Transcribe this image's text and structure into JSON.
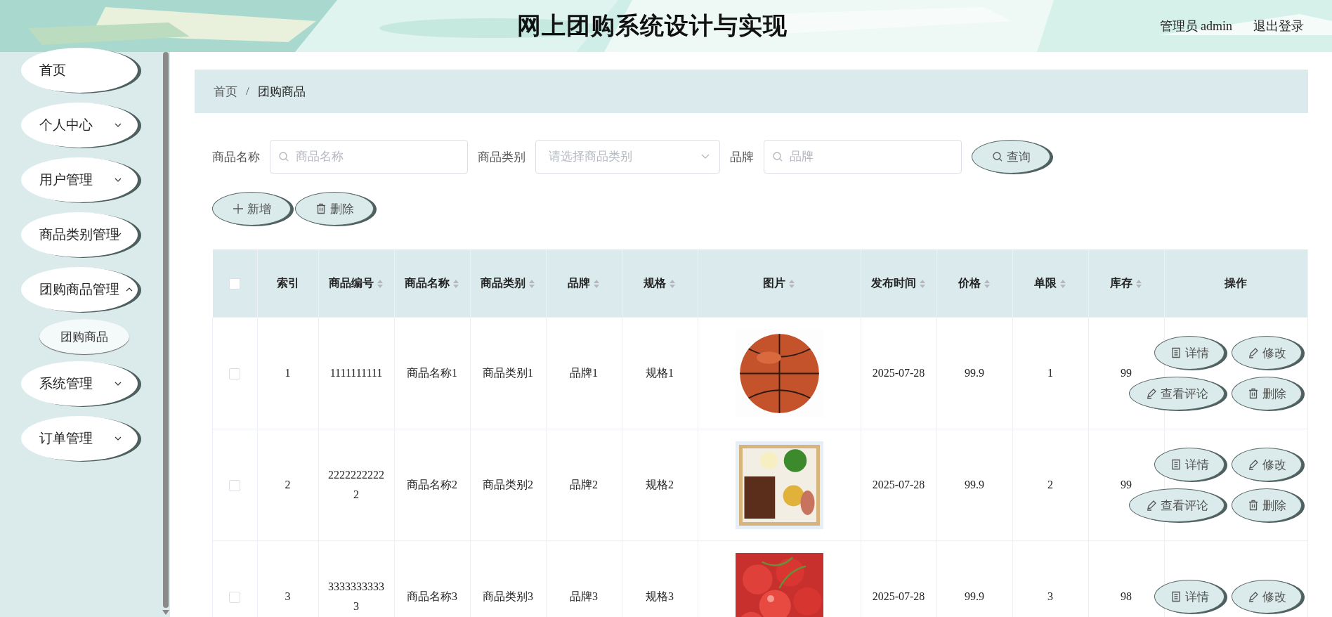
{
  "header": {
    "title": "网上团购系统设计与实现",
    "user": "管理员 admin",
    "logout": "退出登录",
    "background": {
      "kind": "picture"
    }
  },
  "sidebar": {
    "items": [
      {
        "label": "首页",
        "selected": false
      },
      {
        "label": "个人中心",
        "expanded": false,
        "selected": false
      },
      {
        "label": "用户管理",
        "expanded": false,
        "selected": false
      },
      {
        "label": "商品类别管理",
        "expanded": false,
        "selected": false
      },
      {
        "label": "团购商品管理",
        "expanded": true,
        "selected": false,
        "children": [
          {
            "label": "团购商品",
            "selected": true
          }
        ]
      },
      {
        "label": "系统管理",
        "expanded": false,
        "selected": false
      },
      {
        "label": "订单管理",
        "expanded": false,
        "selected": false
      }
    ]
  },
  "breadcrumb": [
    {
      "label": "首页"
    },
    {
      "label": "团购商品"
    }
  ],
  "breadcrumb_separator": "/",
  "filters": [
    {
      "kind": "text",
      "label": "商品名称",
      "placeholder": "商品名称"
    },
    {
      "kind": "select",
      "label": "商品类别",
      "placeholder": "请选择商品类别"
    },
    {
      "kind": "text",
      "label": "品牌",
      "placeholder": "品牌"
    }
  ],
  "search_button": "查询",
  "toolbar": [
    {
      "kind": "add",
      "label": "新增"
    },
    {
      "kind": "delete",
      "label": "删除"
    }
  ],
  "table": {
    "header_checked": false,
    "columns": [
      {
        "label": "索引",
        "sortable": false
      },
      {
        "label": "商品编号",
        "sortable": true
      },
      {
        "label": "商品名称",
        "sortable": true
      },
      {
        "label": "商品类别",
        "sortable": true
      },
      {
        "label": "品牌",
        "sortable": true
      },
      {
        "label": "规格",
        "sortable": true
      },
      {
        "label": "图片",
        "sortable": true
      },
      {
        "label": "发布时间",
        "sortable": true
      },
      {
        "label": "价格",
        "sortable": true
      },
      {
        "label": "单限",
        "sortable": true
      },
      {
        "label": "库存",
        "sortable": true
      },
      {
        "label": "操作",
        "sortable": false
      }
    ],
    "rows": [
      {
        "checked": false,
        "cells": [
          "1",
          "1111111111",
          "商品名称1",
          "商品类别1",
          "品牌1",
          "规格1",
          null,
          "2025-07-28",
          "99.9",
          "1",
          "99"
        ],
        "image": {
          "kind": "picture"
        },
        "actions": [
          {
            "kind": "detail",
            "label": "详情"
          },
          {
            "kind": "edit",
            "label": "修改"
          },
          {
            "kind": "comments",
            "label": "查看评论"
          },
          {
            "kind": "delete",
            "label": "删除"
          }
        ]
      },
      {
        "checked": false,
        "cells": [
          "2",
          "22222222222",
          "商品名称2",
          "商品类别2",
          "品牌2",
          "规格2",
          null,
          "2025-07-28",
          "99.9",
          "2",
          "99"
        ],
        "image": {
          "kind": "picture"
        },
        "actions": [
          {
            "kind": "detail",
            "label": "详情"
          },
          {
            "kind": "edit",
            "label": "修改"
          },
          {
            "kind": "comments",
            "label": "查看评论"
          },
          {
            "kind": "delete",
            "label": "删除"
          }
        ]
      },
      {
        "checked": false,
        "cells": [
          "3",
          "33333333333",
          "商品名称3",
          "商品类别3",
          "品牌3",
          "规格3",
          null,
          "2025-07-28",
          "99.9",
          "3",
          "98"
        ],
        "image": {
          "kind": "picture"
        },
        "actions": [
          {
            "kind": "detail",
            "label": "详情"
          },
          {
            "kind": "edit",
            "label": "修改"
          }
        ]
      }
    ]
  }
}
